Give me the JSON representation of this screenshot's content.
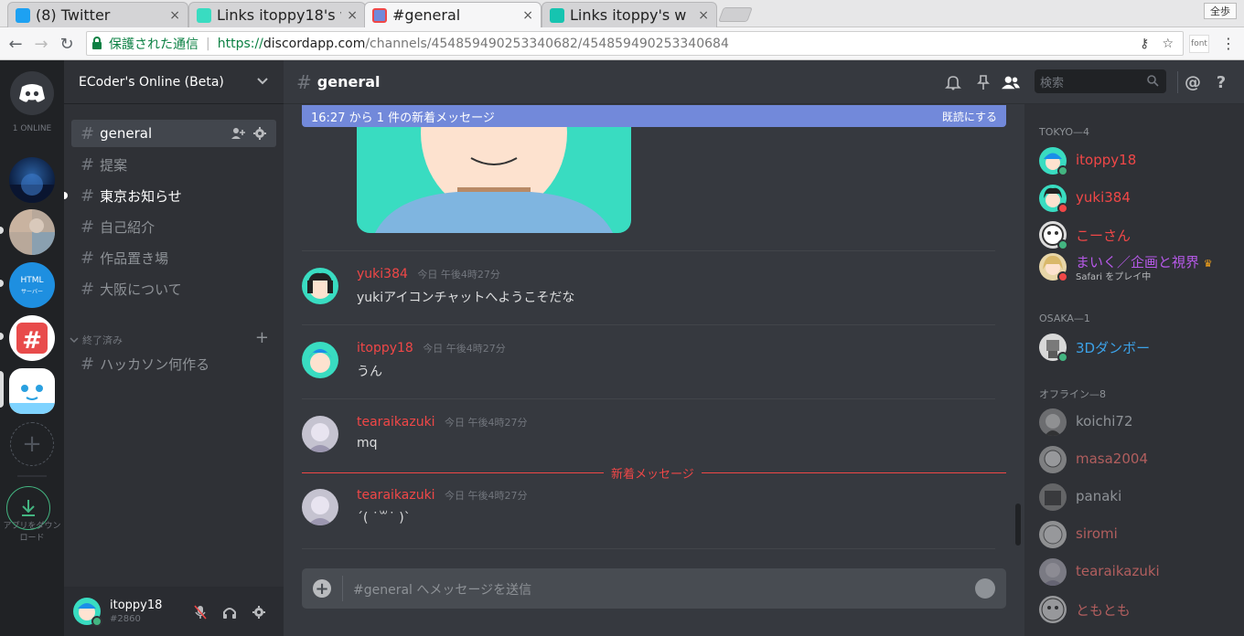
{
  "browser": {
    "tabs": [
      {
        "title": "(8) Twitter",
        "close": "×"
      },
      {
        "title": "Links itoppy18's w",
        "close": "×"
      },
      {
        "title": "#general",
        "close": "×"
      },
      {
        "title": "Links itoppy's w",
        "close": "×"
      }
    ],
    "profile_label": "全歩",
    "secure_label": "保護された通信",
    "url_scheme": "https://",
    "url_host": "discordapp.com",
    "url_path": "/channels/454859490253340682/454859490253340684",
    "ext_label": "font"
  },
  "guilds": {
    "online_count": "1 ONLINE",
    "download_label": "アプリをダウンロード"
  },
  "channels": {
    "guild_name": "ECoder's Online (Beta)",
    "items": [
      {
        "name": "general"
      },
      {
        "name": "提案"
      },
      {
        "name": "東京お知らせ"
      },
      {
        "name": "自己紹介"
      },
      {
        "name": "作品置き場"
      },
      {
        "name": "大阪について"
      }
    ],
    "category": "終了済み",
    "category_items": [
      {
        "name": "ハッカソン何作る"
      }
    ]
  },
  "user": {
    "name": "itoppy18",
    "tag": "#2860"
  },
  "chat": {
    "channel_name": "general",
    "search_placeholder": "検索",
    "banner_text": "16:27 から 1 件の新着メッセージ",
    "banner_action": "既読にする",
    "messages": [
      {
        "author": "yuki384",
        "time": "今日 午後4時27分",
        "text": "yukiアイコンチャットへようこそだな"
      },
      {
        "author": "itoppy18",
        "time": "今日 午後4時27分",
        "text": "うん"
      },
      {
        "author": "tearaikazuki",
        "time": "今日 午後4時27分",
        "text": "mq"
      },
      {
        "author": "tearaikazuki",
        "time": "今日 午後4時27分",
        "text": "´(  ˙꒳˙  )`"
      }
    ],
    "new_divider": "新着メッセージ",
    "composer_placeholder": "#general へメッセージを送信"
  },
  "members": {
    "groups": [
      {
        "name": "TOKYO—4"
      },
      {
        "name": "OSAKA—1"
      },
      {
        "name": "オフライン—8"
      }
    ],
    "tokyo": [
      {
        "name": "itoppy18",
        "color": "#f04747"
      },
      {
        "name": "yuki384",
        "color": "#f04747"
      },
      {
        "name": "こーさん",
        "color": "#f04747"
      },
      {
        "name": "まいく／企画と視界",
        "color": "#b659e8",
        "game": "Safari をプレイ中"
      }
    ],
    "osaka": [
      {
        "name": "3Dダンボー",
        "color": "#3ca2e8"
      }
    ],
    "offline": [
      {
        "name": "koichi72"
      },
      {
        "name": "masa2004"
      },
      {
        "name": "panaki"
      },
      {
        "name": "siromi"
      },
      {
        "name": "tearaikazuki"
      },
      {
        "name": "ともとも"
      }
    ]
  }
}
